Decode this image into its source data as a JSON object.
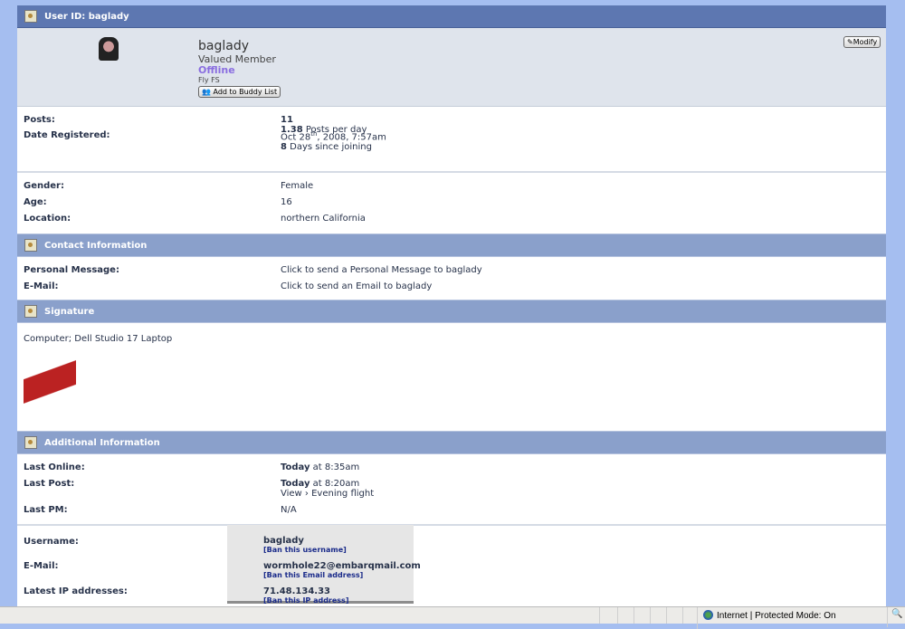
{
  "header": {
    "title": "User ID: baglady"
  },
  "profile": {
    "username": "baglady",
    "rank": "Valued Member",
    "status": "Offline",
    "custom_title": "Fly FS",
    "buddy_button": "Add to Buddy List",
    "modify_button": "Modify"
  },
  "stats": {
    "posts_label": "Posts:",
    "posts": "11",
    "ppd": "1.38",
    "ppd_suffix": " Posts per day",
    "registered_label": "Date Registered:",
    "registered": "Oct 28",
    "registered_sup": "th",
    "registered_rest": ", 2008, 7:57am",
    "days": "8",
    "days_suffix": " Days since joining"
  },
  "personal": {
    "gender_label": "Gender:",
    "gender": "Female",
    "age_label": "Age:",
    "age": "16",
    "location_label": "Location:",
    "location": "northern California"
  },
  "contact": {
    "title": "Contact Information",
    "pm_label": "Personal Message:",
    "pm_link": "Click to send a Personal Message to baglady",
    "email_label": "E-Mail:",
    "email_link": "Click to send an Email to baglady"
  },
  "signature": {
    "title": "Signature",
    "text": "Computer; Dell Studio 17 Laptop"
  },
  "additional": {
    "title": "Additional Information",
    "last_online_label": "Last Online:",
    "last_online_day": "Today",
    "last_online_time": " at 8:35am",
    "last_post_label": "Last Post:",
    "last_post_day": "Today",
    "last_post_time": " at 8:20am",
    "last_post_link": "View › Evening flight",
    "last_pm_label": "Last PM:",
    "last_pm": "N/A"
  },
  "admin": {
    "username_label": "Username:",
    "username": "baglady",
    "ban_username": "[Ban this username]",
    "email_label": "E-Mail:",
    "email": "wormhole22@embarqmail.com",
    "ban_email": "[Ban this Email address]",
    "ip_label": "Latest IP addresses:",
    "ip": "71.48.134.33",
    "ban_ip": "[Ban this IP address]"
  },
  "statusbar": {
    "zone": "Internet | Protected Mode: On"
  }
}
